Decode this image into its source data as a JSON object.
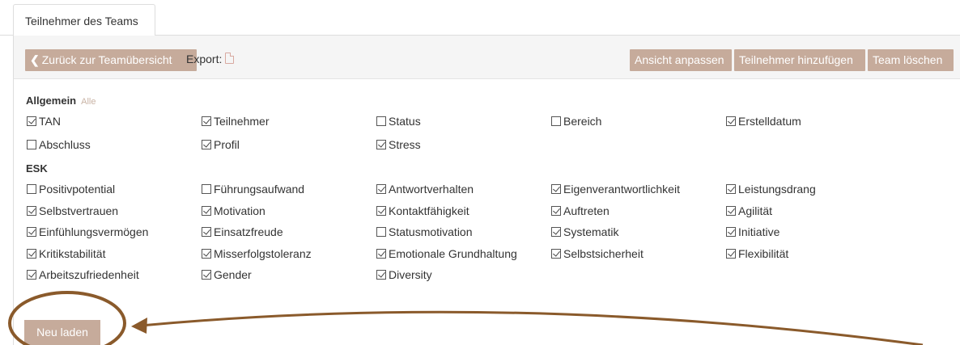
{
  "tab": {
    "label": "Teilnehmer des Teams"
  },
  "toolbar": {
    "back_label": "Zurück zur Teamübersicht",
    "export_label": "Export:",
    "view_label": "Ansicht anpassen",
    "add_label": "Teilnehmer hinzufügen",
    "delete_label": "Team löschen"
  },
  "sections": {
    "allgemein": {
      "title": "Allgemein",
      "all_label": "Alle"
    },
    "esk": {
      "title": "ESK"
    }
  },
  "allgemein_items": [
    {
      "label": "TAN",
      "checked": true
    },
    {
      "label": "Teilnehmer",
      "checked": true
    },
    {
      "label": "Status",
      "checked": false
    },
    {
      "label": "Bereich",
      "checked": false
    },
    {
      "label": "Erstelldatum",
      "checked": true
    },
    {
      "label": "Abschluss",
      "checked": false
    },
    {
      "label": "Profil",
      "checked": true
    },
    {
      "label": "Stress",
      "checked": true
    }
  ],
  "esk_items": [
    {
      "label": "Positivpotential",
      "checked": false
    },
    {
      "label": "Führungsaufwand",
      "checked": false
    },
    {
      "label": "Antwortverhalten",
      "checked": true
    },
    {
      "label": "Eigenverantwortlichkeit",
      "checked": true
    },
    {
      "label": "Leistungsdrang",
      "checked": true
    },
    {
      "label": "Selbstvertrauen",
      "checked": true
    },
    {
      "label": "Motivation",
      "checked": true
    },
    {
      "label": "Kontaktfähigkeit",
      "checked": true
    },
    {
      "label": "Auftreten",
      "checked": true
    },
    {
      "label": "Agilität",
      "checked": true
    },
    {
      "label": "Einfühlungsvermögen",
      "checked": true
    },
    {
      "label": "Einsatzfreude",
      "checked": true
    },
    {
      "label": "Statusmotivation",
      "checked": false
    },
    {
      "label": "Systematik",
      "checked": true
    },
    {
      "label": "Initiative",
      "checked": true
    },
    {
      "label": "Kritikstabilität",
      "checked": true
    },
    {
      "label": "Misserfolgstoleranz",
      "checked": true
    },
    {
      "label": "Emotionale Grundhaltung",
      "checked": true
    },
    {
      "label": "Selbstsicherheit",
      "checked": true
    },
    {
      "label": "Flexibilität",
      "checked": true
    },
    {
      "label": "Arbeitszufriedenheit",
      "checked": true
    },
    {
      "label": "Gender",
      "checked": true
    },
    {
      "label": "Diversity",
      "checked": true
    }
  ],
  "reload_label": "Neu laden",
  "colors": {
    "accent": "#c6ab9b",
    "annotation": "#8a5a2b"
  }
}
